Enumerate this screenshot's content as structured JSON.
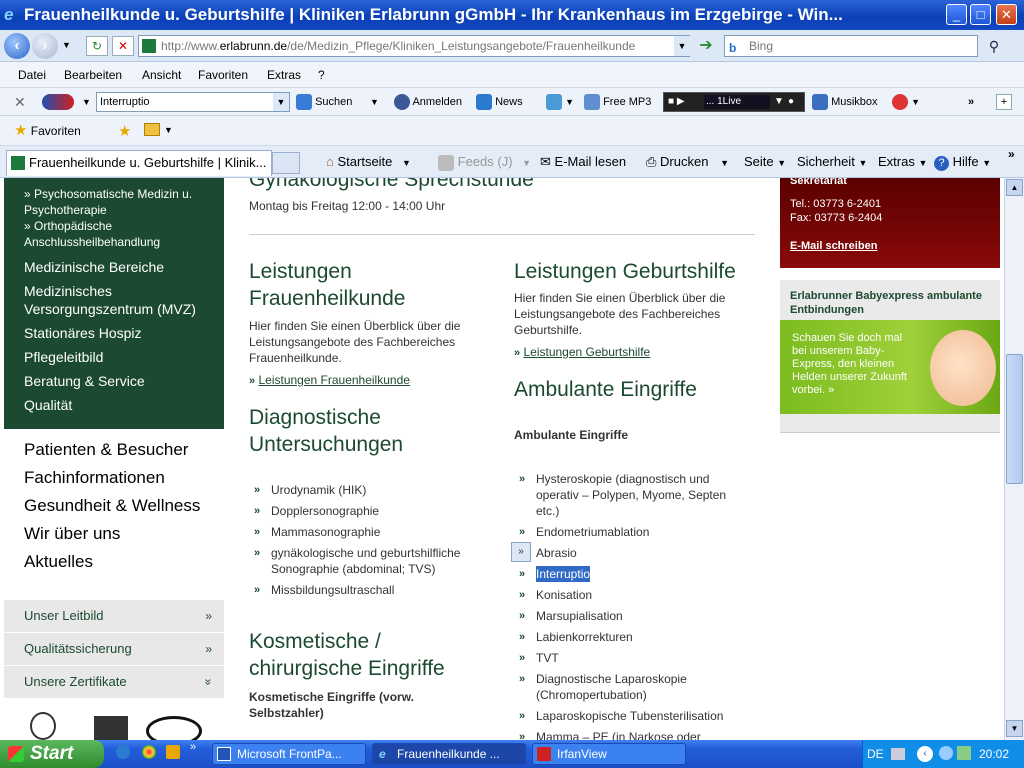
{
  "window": {
    "title": "Frauenheilkunde u. Geburtshilfe | Kliniken Erlabrunn gGmbH - Ihr Krankenhaus im Erzgebirge - Win...",
    "minimize": "_",
    "maximize": "□",
    "close": "✕"
  },
  "address": {
    "url_prefix": "http://www.",
    "url_host": "erlabrunn.de",
    "url_rest": "/de/Medizin_Pflege/Kliniken_Leistungsangebote/Frauenheilkunde",
    "search_placeholder": "Bing"
  },
  "menu": [
    "Datei",
    "Bearbeiten",
    "Ansicht",
    "Favoriten",
    "Extras",
    "?"
  ],
  "toolbar1": {
    "search_value": "Interruptio",
    "suchen": "Suchen",
    "anmelden": "Anmelden",
    "news": "News",
    "freemp3": "Free MP3",
    "radio": "... 1Live",
    "musikbox": "Musikbox"
  },
  "toolbar2": {
    "favoriten": "Favoriten"
  },
  "toolbar3": {
    "tab": "Frauenheilkunde u. Geburtshilfe | Klinik...",
    "startseite": "Startseite",
    "feeds": "Feeds (J)",
    "email": "E-Mail lesen",
    "drucken": "Drucken",
    "seite": "Seite",
    "sicherheit": "Sicherheit",
    "extras": "Extras",
    "hilfe": "Hilfe"
  },
  "leftnav": {
    "sub": [
      "Psychosomatische Medizin u. Psychotherapie",
      "Orthopädische Anschlussheilbehandlung"
    ],
    "main": [
      "Medizinische Bereiche",
      "Medizinisches Versorgungszentrum (MVZ)",
      "Stationäres Hospiz",
      "Pflegeleitbild",
      "Beratung & Service",
      "Qualität"
    ],
    "plain": [
      "Patienten & Besucher",
      "Fachinformationen",
      "Gesundheit & Wellness",
      "Wir über uns",
      "Aktuelles"
    ],
    "grey": [
      "Unser Leitbild",
      "Qualitätssicherung",
      "Unsere Zertifikate"
    ]
  },
  "content": {
    "top_heading_partial": "Gynäkologische Sprechstunde",
    "hours": "Montag bis Freitag 12:00 - 14:00 Uhr",
    "fh_title": "Leistungen Frauenheilkunde",
    "fh_text": "Hier finden Sie einen Überblick über die Leistungsangebote des Fachbereiches Frauenheilkunde.",
    "fh_link": "Leistungen Frauenheilkunde",
    "gh_title": "Leistungen Geburtshilfe",
    "gh_text": "Hier finden Sie einen Überblick über die Leistungsangebote des Fachbereiches Geburtshilfe.",
    "gh_link": "Leistungen Geburtshilfe",
    "diag_title": "Diagnostische Untersuchungen",
    "diag_items": [
      "Urodynamik (HIK)",
      "Dopplersonographie",
      "Mammasonographie",
      "gynäkologische und geburtshilfliche Sonographie (abdominal; TVS)",
      "Missbildungsultraschall"
    ],
    "amb_title": "Ambulante Eingriffe",
    "amb_sub": "Ambulante Eingriffe",
    "amb_items": [
      "Hysteroskopie (diagnostisch und operativ – Polypen, Myome, Septen etc.)",
      "Endometriumablation",
      "Abrasio",
      "Interruptio",
      "Konisation",
      "Marsupialisation",
      "Labienkorrekturen",
      "TVT",
      "Diagnostische Laparoskopie (Chromopertubation)",
      "Laparoskopische Tubensterilisation",
      "Mamma – PE (in Narkose oder"
    ],
    "kos_title": "Kosmetische / chirurgische Eingriffe",
    "kos_sub": "Kosmetische Eingriffe (vorw. Selbstzahler)"
  },
  "sidebar": {
    "sekretariat": "Sekretariat",
    "tel": "Tel.: 03773 6-2401",
    "fax": "Fax: 03773 6-2404",
    "mail": "E-Mail schreiben",
    "baby_title": "Erlabrunner Babyexpress ambulante Entbindungen",
    "baby_text": "Schauen Sie doch mal bei unserem Baby-Express, den kleinen Helden unserer Zukunft vorbei. »"
  },
  "taskbar": {
    "start": "Start",
    "tasks": [
      "Microsoft FrontPa...",
      "Frauenheilkunde ...",
      "IrfanView"
    ],
    "lang": "DE",
    "time": "20:02"
  }
}
